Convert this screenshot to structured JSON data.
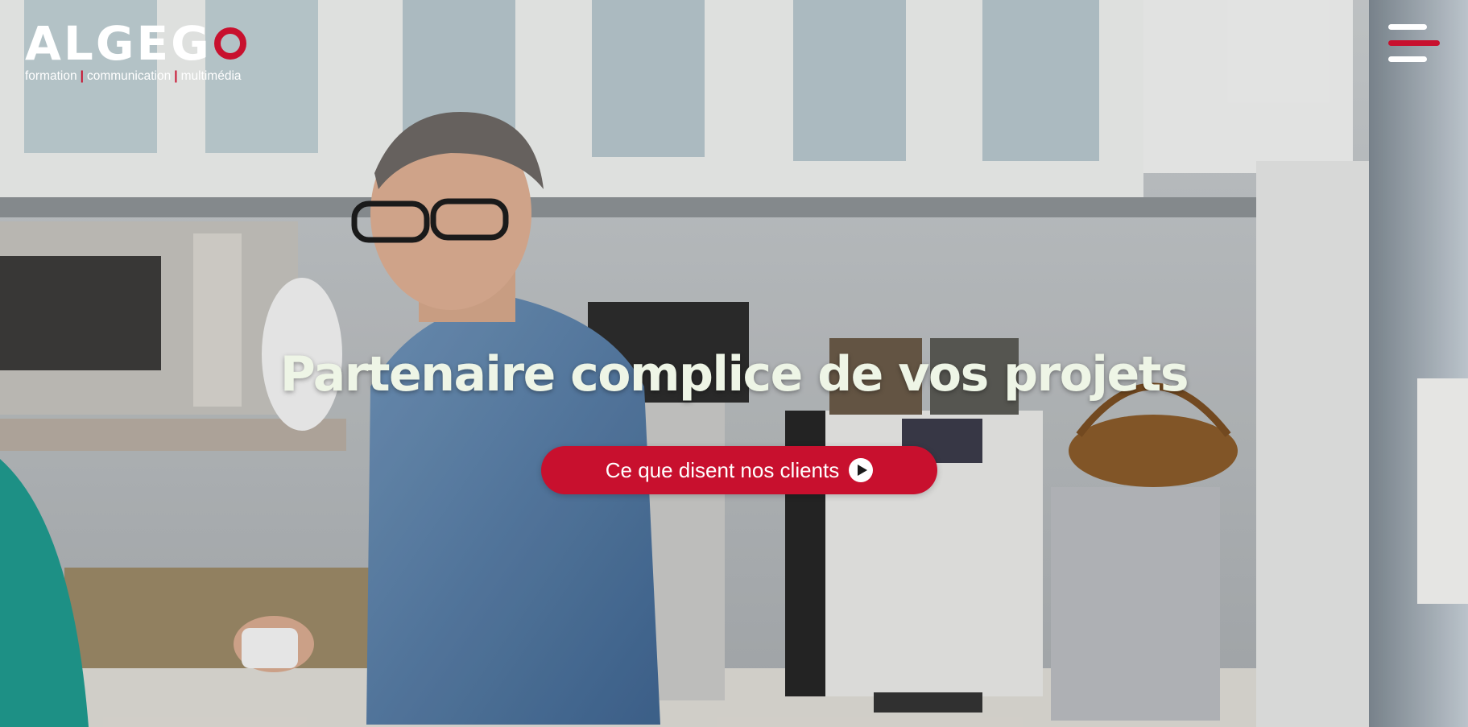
{
  "brand": {
    "name": "ALGEG",
    "tagline_parts": [
      "formation",
      "communication",
      "multimédia"
    ],
    "separator": "|",
    "accent_color": "#c8102e"
  },
  "header": {
    "menu_icon": "hamburger-menu-icon"
  },
  "hero": {
    "headline": "Partenaire complice de vos projets",
    "cta_label": "Ce que disent nos clients",
    "cta_icon": "play-circle-icon"
  }
}
